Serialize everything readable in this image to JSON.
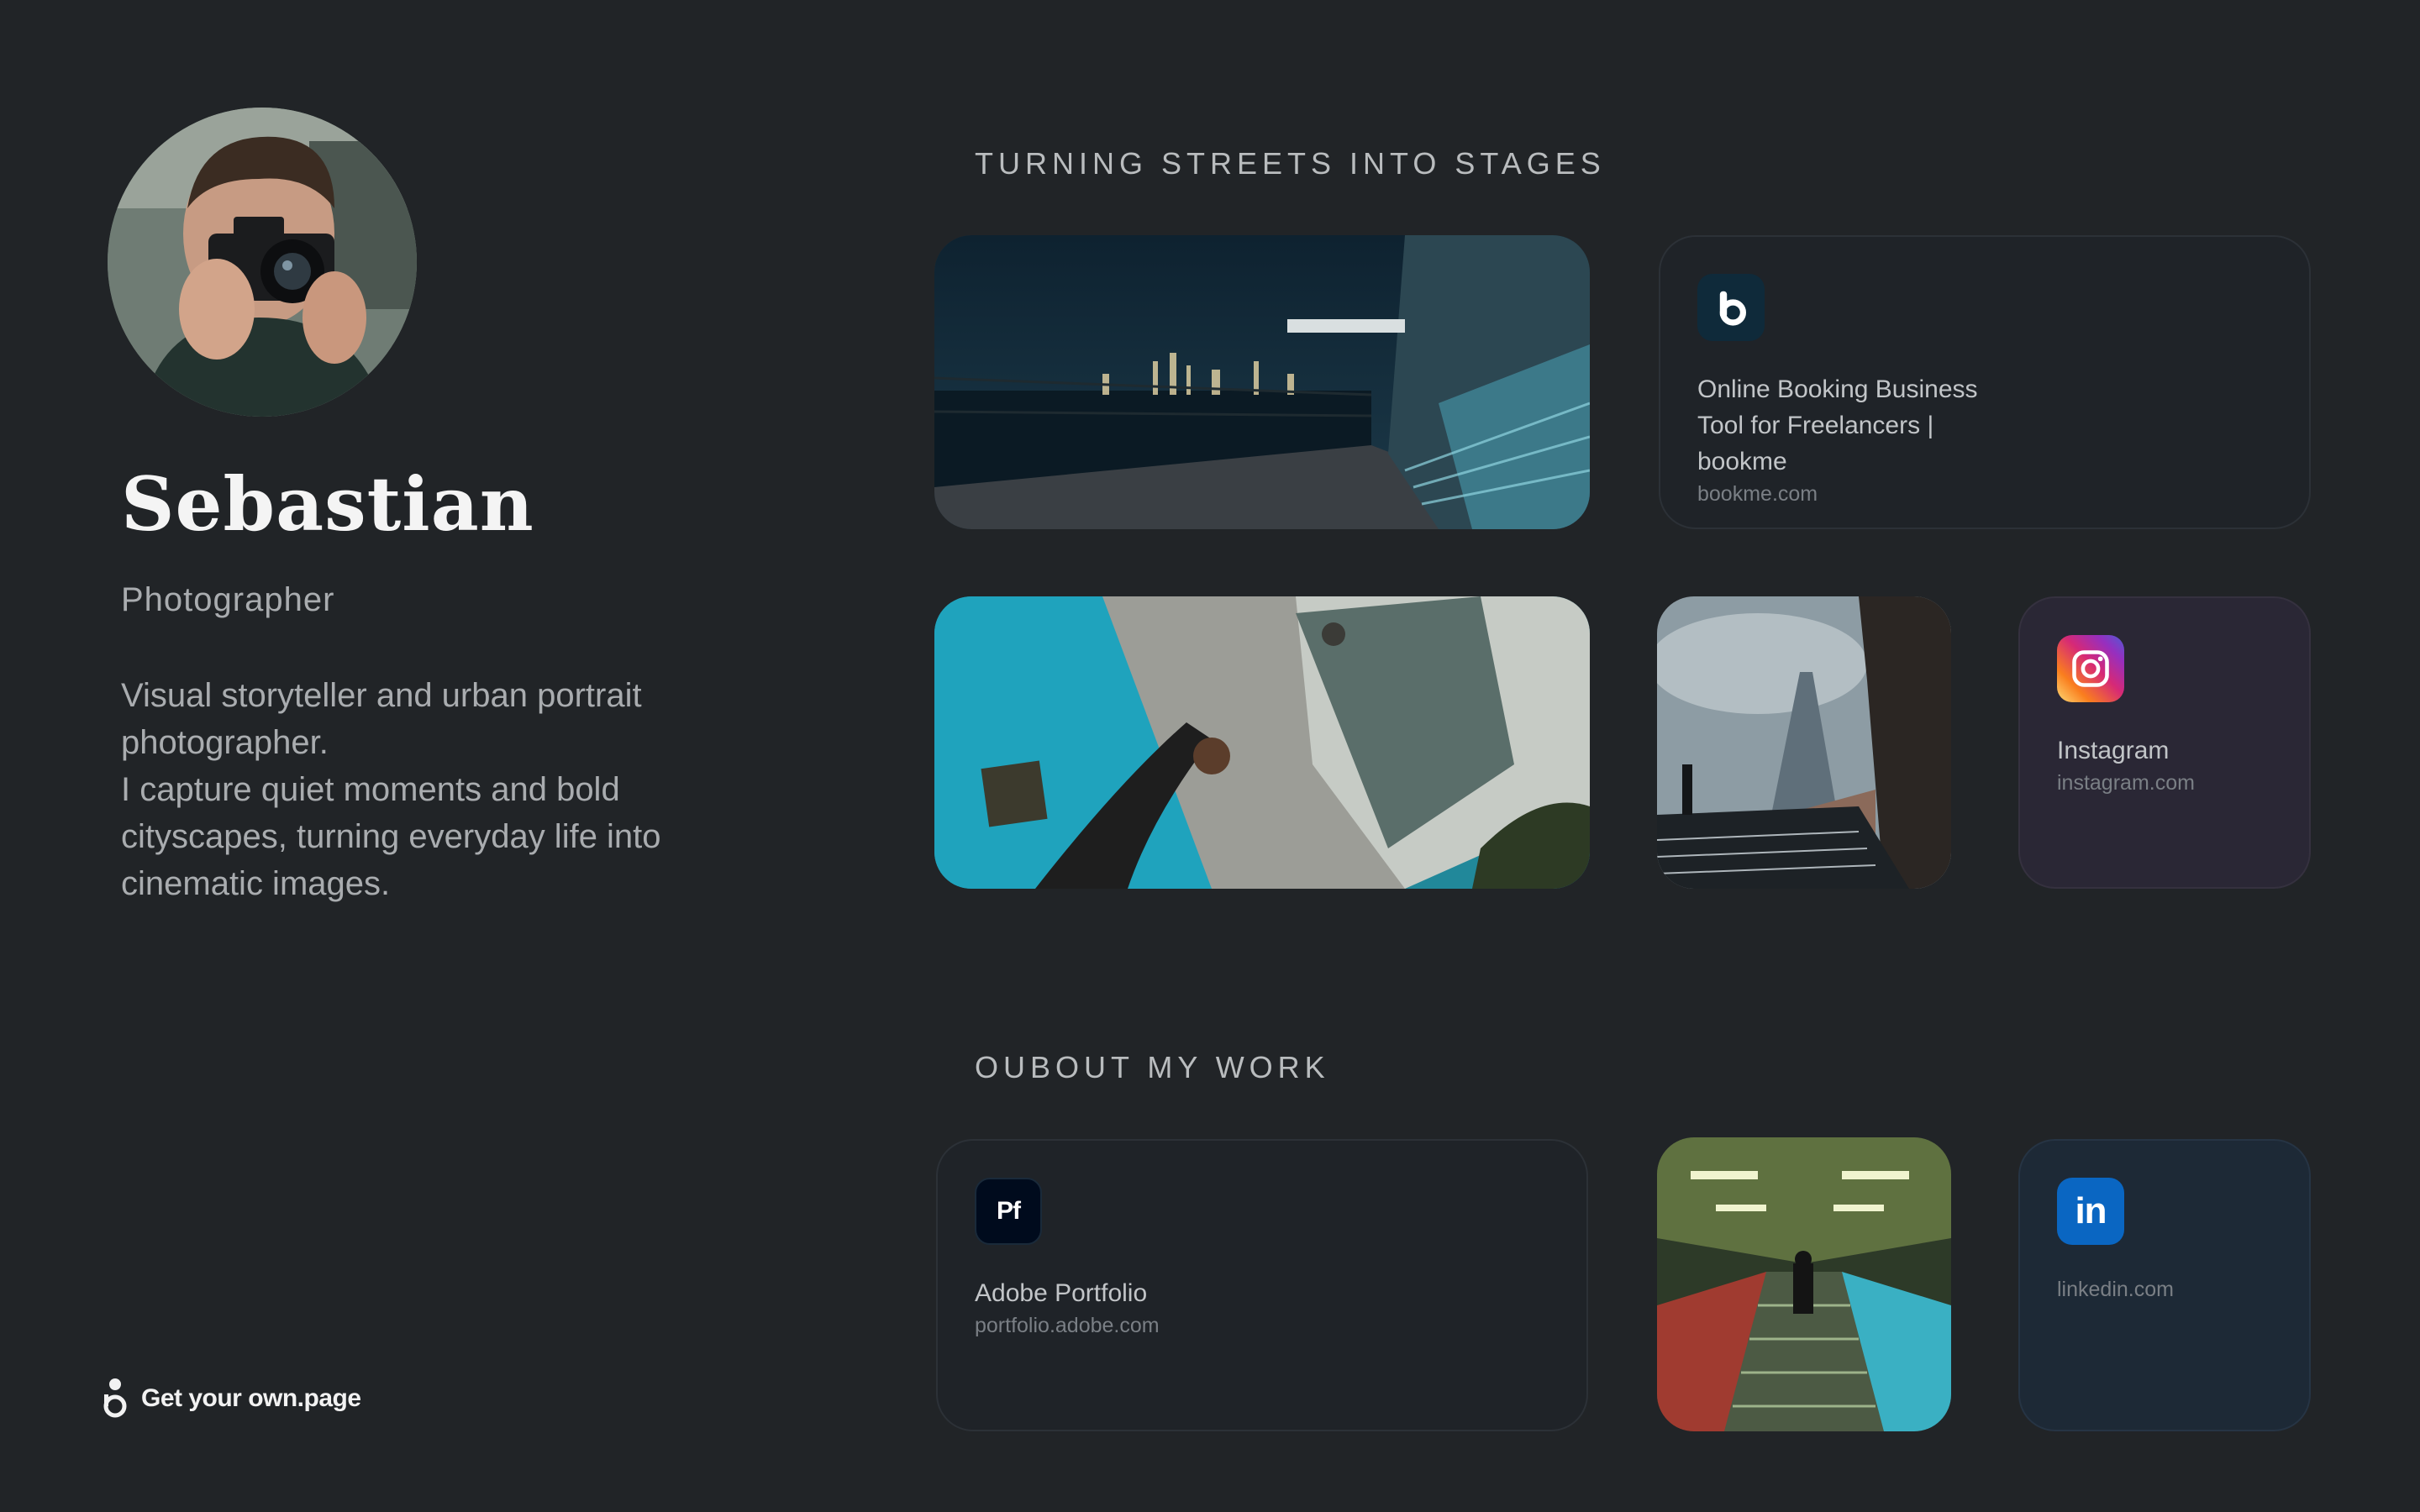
{
  "profile": {
    "name": "Sebastian",
    "role": "Photographer",
    "bio_line1": "Visual storyteller and urban portrait photographer.",
    "bio_line2": "I capture quiet moments and bold cityscapes, turning everyday life into cinematic images."
  },
  "footer": {
    "cta_label": "Get your own.page"
  },
  "sections": {
    "first_title": "TURNING STREETS INTO STAGES",
    "second_title": "OUBOUT MY WORK"
  },
  "links": {
    "bookme": {
      "title": "Online Booking Business Tool for Freelancers | bookme",
      "url": "bookme.com",
      "icon": "bookme-b-icon",
      "color": "#0f2a3a"
    },
    "instagram": {
      "title": "Instagram",
      "url": "instagram.com",
      "icon": "instagram-icon"
    },
    "adobe": {
      "title": "Adobe Portfolio",
      "url": "portfolio.adobe.com",
      "icon": "adobe-portfolio-icon",
      "glyph": "Pf",
      "color": "#000b1d"
    },
    "linkedin": {
      "url": "linkedin.com",
      "icon": "linkedin-icon",
      "glyph": "in",
      "color": "#0a66c2"
    }
  },
  "colors": {
    "background": "#212427",
    "instagram_card": "#2a2735",
    "linkedin_card": "#1d2936"
  }
}
